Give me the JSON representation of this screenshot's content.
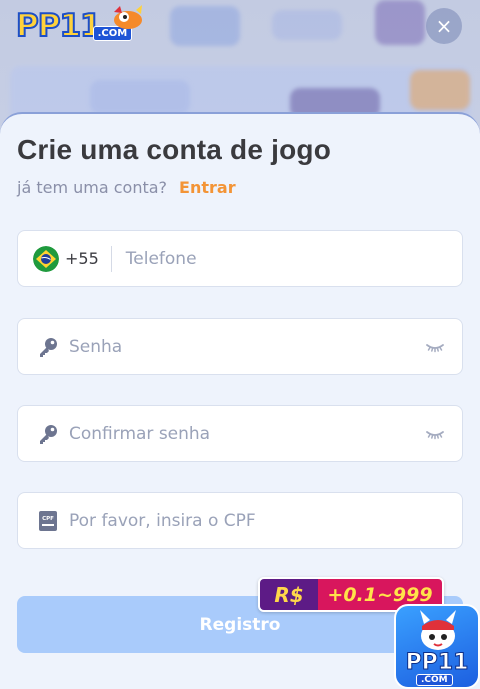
{
  "header": {
    "logo_text": "PP11",
    "logo_suffix": ".COM",
    "close_label": "×"
  },
  "form": {
    "title": "Crie uma conta de jogo",
    "subtitle": "já tem uma conta?",
    "login_link": "Entrar",
    "phone": {
      "country_code": "+55",
      "placeholder": "Telefone",
      "flag": "brazil-flag-icon"
    },
    "password": {
      "placeholder": "Senha",
      "icon": "key-icon",
      "toggle_icon": "eye-closed-icon"
    },
    "confirm_password": {
      "placeholder": "Confirmar senha",
      "icon": "key-icon",
      "toggle_icon": "eye-closed-icon"
    },
    "cpf": {
      "placeholder": "Por favor, insira o CPF",
      "icon": "cpf-card-icon"
    },
    "submit_label": "Registro"
  },
  "bonus_badge": {
    "currency": "R$",
    "amount": "+0.1~999"
  },
  "app_icon": {
    "text": "PP11",
    "suffix": ".COM"
  },
  "colors": {
    "accent_link": "#f39436",
    "submit_disabled": "#a9cbfb",
    "modal_bg": "#eef3fc",
    "badge_left": "#5d1b86",
    "badge_right": "#d8165d"
  }
}
